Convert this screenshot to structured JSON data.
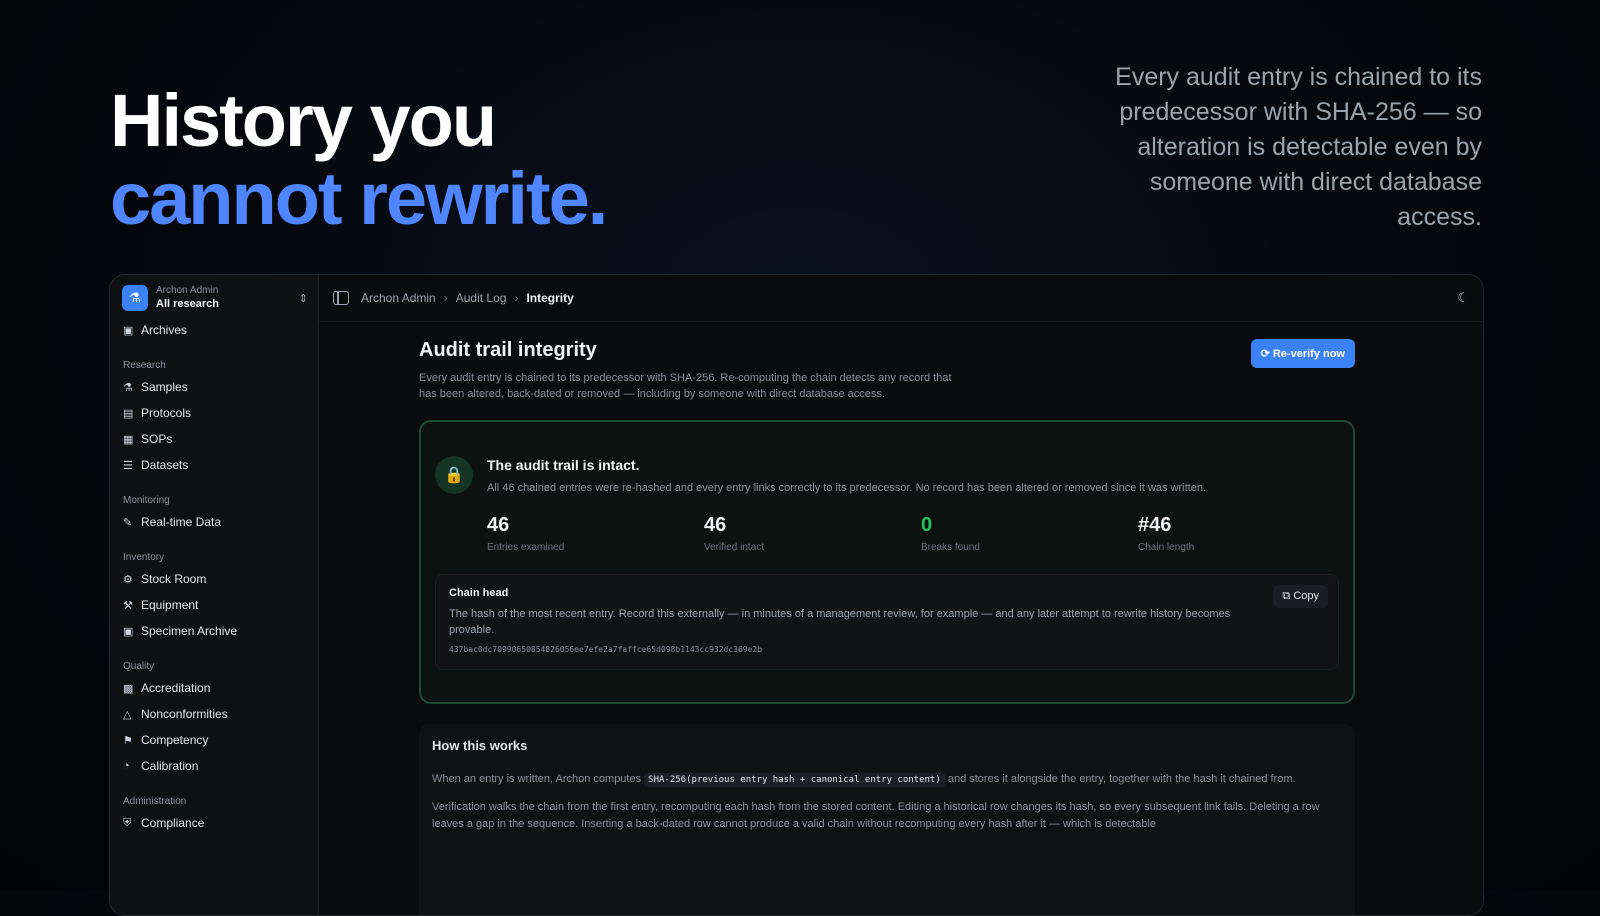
{
  "hero": {
    "line1": "History you",
    "line2": "cannot rewrite.",
    "subtitle": "Every audit entry is chained to its predecessor with SHA-256 — so alteration is detectable even by someone with direct database access."
  },
  "sidebar": {
    "workspace_name": "Archon Admin",
    "workspace_selected": "All research",
    "top_item": {
      "label": "Archives",
      "icon": "archive-icon"
    },
    "sections": [
      {
        "title": "Research",
        "items": [
          {
            "label": "Samples",
            "icon": "flask-icon"
          },
          {
            "label": "Protocols",
            "icon": "clipboard-icon"
          },
          {
            "label": "SOPs",
            "icon": "document-icon"
          },
          {
            "label": "Datasets",
            "icon": "database-icon"
          }
        ]
      },
      {
        "title": "Monitoring",
        "items": [
          {
            "label": "Real-time Data",
            "icon": "pencil-icon"
          }
        ]
      },
      {
        "title": "Inventory",
        "items": [
          {
            "label": "Stock Room",
            "icon": "box-icon"
          },
          {
            "label": "Equipment",
            "icon": "wrench-icon"
          },
          {
            "label": "Specimen Archive",
            "icon": "archive-icon"
          }
        ]
      },
      {
        "title": "Quality",
        "items": [
          {
            "label": "Accreditation",
            "icon": "badge-icon"
          },
          {
            "label": "Nonconformities",
            "icon": "warning-icon"
          },
          {
            "label": "Competency",
            "icon": "cap-icon"
          },
          {
            "label": "Calibration",
            "icon": "gauge-icon"
          }
        ]
      },
      {
        "title": "Administration",
        "items": [
          {
            "label": "Compliance",
            "icon": "shield-icon"
          }
        ]
      }
    ]
  },
  "breadcrumb": [
    "Archon Admin",
    "Audit Log",
    "Integrity"
  ],
  "page": {
    "title": "Audit trail integrity",
    "description": "Every audit entry is chained to its predecessor with SHA-256. Re-computing the chain detects any record that has been altered, back-dated or removed — including by someone with direct database access.",
    "reverify_label": "Re-verify now"
  },
  "status": {
    "title": "The audit trail is intact.",
    "description": "All 46 chained entries were re-hashed and every entry links correctly to its predecessor. No record has been altered or removed since it was written.",
    "stats": [
      {
        "value": "46",
        "label": "Entries examined"
      },
      {
        "value": "46",
        "label": "Verified intact"
      },
      {
        "value": "0",
        "label": "Breaks found"
      },
      {
        "value": "#46",
        "label": "Chain length"
      }
    ],
    "breaks_color": "#22c55e"
  },
  "chain_head": {
    "title": "Chain head",
    "description": "The hash of the most recent entry. Record this externally — in minutes of a management review, for example — and any later attempt to rewrite history becomes provable.",
    "hash": "437bac0dc70990650854826056ee7efe2a7faffce65d098b1143cc932dc369e2b",
    "copy_label": "Copy"
  },
  "how": {
    "title": "How this works",
    "p1_pre": "When an entry is written, Archon computes",
    "p1_code": "SHA-256(previous entry hash + canonical entry content)",
    "p1_post": "and stores it alongside the entry, together with the hash it chained from.",
    "p2": "Verification walks the chain from the first entry, recomputing each hash from the stored content. Editing a historical row changes its hash, so every subsequent link fails. Deleting a row leaves a gap in the sequence. Inserting a back-dated row cannot produce a valid chain without recomputing every hash after it — which is detectable"
  },
  "colors": {
    "accent": "#4f86ff",
    "button": "#3b82f6",
    "success": "#22c55e"
  }
}
